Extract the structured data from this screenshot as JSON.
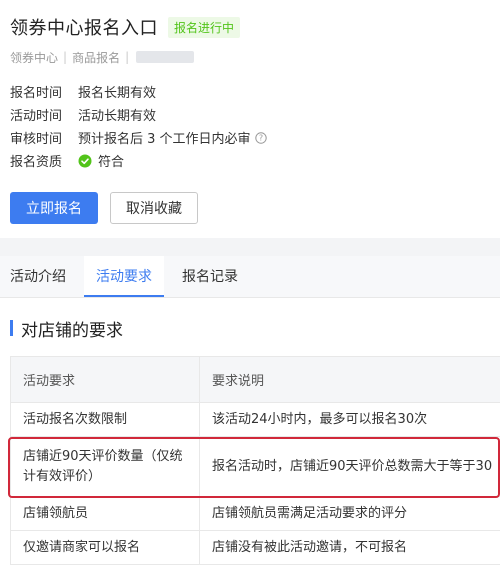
{
  "header": {
    "title": "领券中心报名入口",
    "status": "报名进行中",
    "breadcrumb": [
      "领券中心",
      "商品报名"
    ]
  },
  "info": [
    {
      "label": "报名时间",
      "value": "报名长期有效"
    },
    {
      "label": "活动时间",
      "value": "活动长期有效"
    },
    {
      "label": "审核时间",
      "value": "预计报名后 3 个工作日内必审"
    },
    {
      "label": "报名资质",
      "value": "符合"
    }
  ],
  "buttons": {
    "apply": "立即报名",
    "unfavorite": "取消收藏"
  },
  "tabs": [
    "活动介绍",
    "活动要求",
    "报名记录"
  ],
  "section": {
    "title": "对店铺的要求"
  },
  "table": {
    "headers": [
      "活动要求",
      "要求说明"
    ],
    "rows": [
      {
        "req": "活动报名次数限制",
        "desc": "该活动24小时内，最多可以报名30次"
      },
      {
        "req": "店铺近90天评价数量（仅统计有效评价）",
        "desc": "报名活动时，店铺近90天评价总数需大于等于30"
      },
      {
        "req": "店铺领航员",
        "desc": "店铺领航员需满足活动要求的评分"
      },
      {
        "req": "仅邀请商家可以报名",
        "desc": "店铺没有被此活动邀请，不可报名"
      }
    ]
  },
  "colors": {
    "accent": "#3d7cf0",
    "status_green": "#52c41a",
    "highlight_red": "#d1283a"
  }
}
